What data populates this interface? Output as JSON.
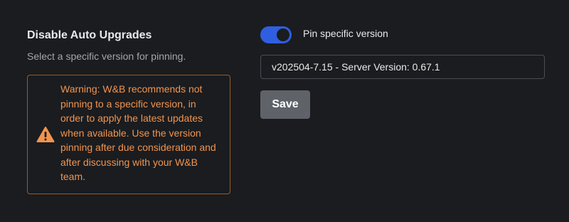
{
  "section": {
    "title": "Disable Auto Upgrades",
    "subtitle": "Select a specific version for pinning."
  },
  "warning": {
    "icon": "warning-triangle-icon",
    "text": "Warning: W&B recommends not pinning to a specific version, in order to apply the latest updates when available. Use the version pinning after due consideration and after discussing with your W&B team.",
    "color": "#f2944f",
    "border_color": "#9a5a2a"
  },
  "pin_toggle": {
    "label": "Pin specific version",
    "checked": true,
    "color": "#2f5fe0"
  },
  "version_select": {
    "value": "v202504-7.15 - Server Version: 0.67.1"
  },
  "save_button": {
    "label": "Save",
    "disabled": true
  },
  "colors": {
    "background": "#1a1c1f",
    "text_primary": "#e8e9eb",
    "text_secondary": "#a3a6ab",
    "button_bg": "#5f6369"
  }
}
